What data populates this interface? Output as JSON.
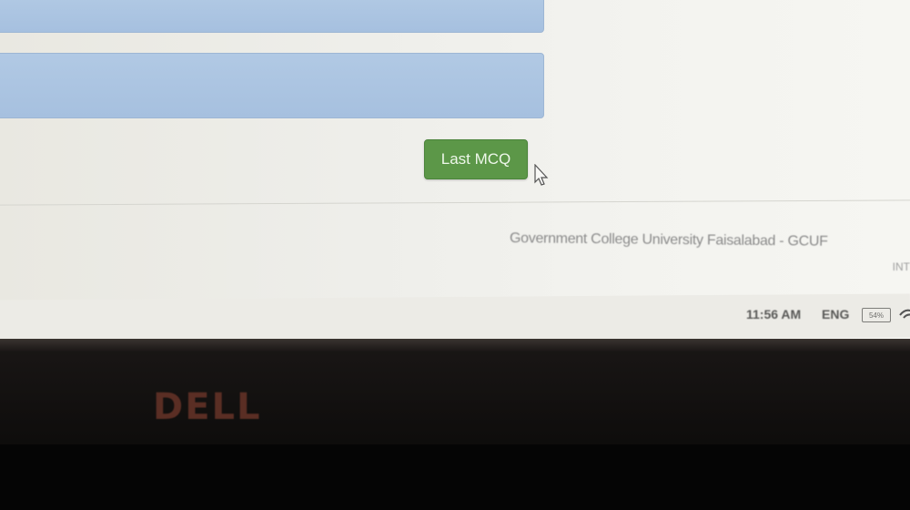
{
  "form": {
    "last_mcq_label": "Last MCQ"
  },
  "footer": {
    "text": "Government College University Faisalabad - GCUF",
    "edge_text": "INT"
  },
  "taskbar": {
    "time": "11:56 AM",
    "language": "ENG",
    "battery": "54%"
  },
  "monitor": {
    "brand": "DELL"
  },
  "colors": {
    "accent_green": "#5c9748",
    "field_blue": "#a6c0df",
    "page_bg": "#eeeeea"
  }
}
